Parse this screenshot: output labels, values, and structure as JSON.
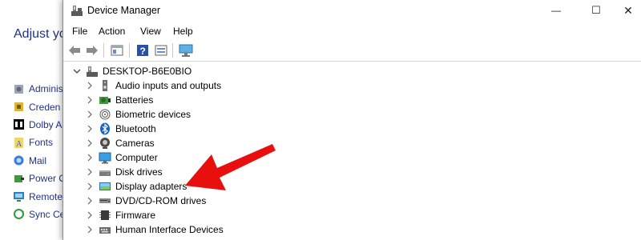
{
  "control_panel": {
    "heading": "Adjust yo",
    "items": [
      {
        "label": "Adminis",
        "icon": "admin-tools-icon"
      },
      {
        "label": "Creden",
        "icon": "credential-manager-icon"
      },
      {
        "label": "Dolby A",
        "icon": "dolby-icon"
      },
      {
        "label": "Fonts",
        "icon": "fonts-icon"
      },
      {
        "label": "Mail",
        "icon": "mail-icon"
      },
      {
        "label": "Power O",
        "icon": "power-options-icon"
      },
      {
        "label": "Remote",
        "icon": "remoteapp-icon"
      },
      {
        "label": "Sync Ce",
        "icon": "sync-center-icon"
      }
    ]
  },
  "window": {
    "title": "Device Manager",
    "controls": {
      "minimize": "—",
      "maximize": "☐",
      "close": "✕"
    }
  },
  "menu": [
    "File",
    "Action",
    "View",
    "Help"
  ],
  "toolbar": [
    "back-icon",
    "forward-icon",
    "properties-icon",
    "help-icon",
    "update-driver-icon",
    "scan-hardware-icon"
  ],
  "tree": {
    "root": "DESKTOP-B6E0BIO",
    "categories": [
      {
        "label": "Audio inputs and outputs",
        "icon": "speaker-icon"
      },
      {
        "label": "Batteries",
        "icon": "battery-icon"
      },
      {
        "label": "Biometric devices",
        "icon": "fingerprint-icon"
      },
      {
        "label": "Bluetooth",
        "icon": "bluetooth-icon"
      },
      {
        "label": "Cameras",
        "icon": "camera-icon"
      },
      {
        "label": "Computer",
        "icon": "computer-icon"
      },
      {
        "label": "Disk drives",
        "icon": "disk-drive-icon"
      },
      {
        "label": "Display adapters",
        "icon": "display-adapter-icon"
      },
      {
        "label": "DVD/CD-ROM drives",
        "icon": "dvd-drive-icon"
      },
      {
        "label": "Firmware",
        "icon": "firmware-icon"
      },
      {
        "label": "Human Interface Devices",
        "icon": "hid-icon"
      }
    ]
  },
  "annotation": {
    "arrow_color": "#e8100f",
    "points_to": "Display adapters"
  }
}
